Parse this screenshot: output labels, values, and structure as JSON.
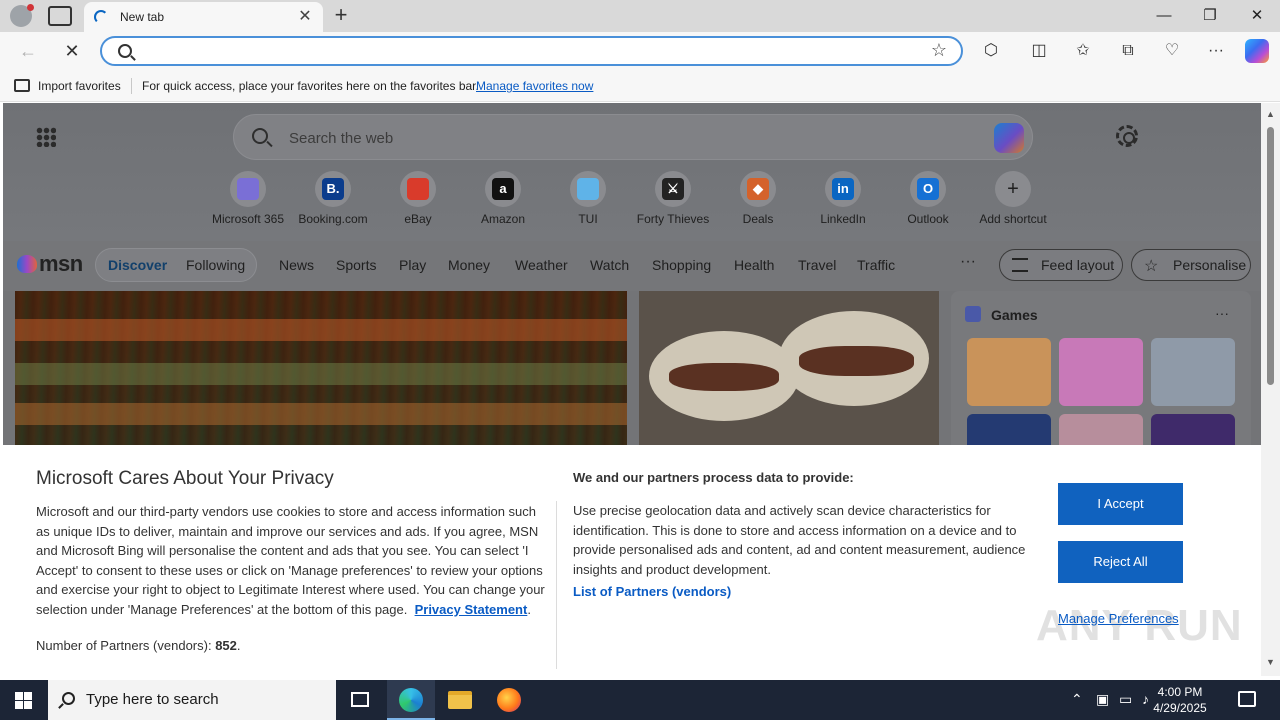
{
  "browser": {
    "tab_title": "New tab",
    "address_value": "",
    "favorites_bar": {
      "import_label": "Import favorites",
      "message": "For quick access, place your favorites here on the favorites bar.",
      "manage_link": "Manage favorites now"
    }
  },
  "newtab": {
    "search_placeholder": "Search the web",
    "shortcuts": [
      {
        "label": "Microsoft 365",
        "icon": "microsoft-365-icon",
        "glyph": "",
        "color": "#7a6fd6"
      },
      {
        "label": "Booking.com",
        "icon": "booking-icon",
        "glyph": "B.",
        "color": "#0b3c8c"
      },
      {
        "label": "eBay",
        "icon": "ebay-icon",
        "glyph": "",
        "color": "#d93b2b"
      },
      {
        "label": "Amazon",
        "icon": "amazon-icon",
        "glyph": "a",
        "color": "#111111"
      },
      {
        "label": "TUI",
        "icon": "tui-icon",
        "glyph": "",
        "color": "#5fb3e8"
      },
      {
        "label": "Forty Thieves",
        "icon": "forty-thieves-icon",
        "glyph": "⚔",
        "color": "#222222"
      },
      {
        "label": "Deals",
        "icon": "deals-icon",
        "glyph": "◆",
        "color": "#d4622b"
      },
      {
        "label": "LinkedIn",
        "icon": "linkedin-icon",
        "glyph": "in",
        "color": "#0a66c2"
      },
      {
        "label": "Outlook",
        "icon": "outlook-icon",
        "glyph": "O",
        "color": "#1570d4"
      },
      {
        "label": "Add shortcut",
        "icon": "plus-icon",
        "glyph": "+",
        "color": "transparent"
      }
    ]
  },
  "msn": {
    "logo": "msn",
    "discover": "Discover",
    "following": "Following",
    "nav": [
      "News",
      "Sports",
      "Play",
      "Money",
      "Weather",
      "Watch",
      "Shopping",
      "Health",
      "Travel",
      "Traffic"
    ],
    "more": "···",
    "feed_layout": "Feed layout",
    "personalise": "Personalise",
    "games_title": "Games",
    "games_more": "···"
  },
  "privacy": {
    "title": "Microsoft Cares About Your Privacy",
    "body": "Microsoft and our third-party vendors use cookies to store and access information such as unique IDs to deliver, maintain and improve our services and ads. If you agree, MSN and Microsoft Bing will personalise the content and ads that you see. You can select 'I Accept' to consent to these uses or click on 'Manage preferences' to review your options and exercise your right to object to Legitimate Interest where used.  You can change your selection under 'Manage Preferences' at the bottom of this page.",
    "privacy_link": "Privacy Statement",
    "partners_label": "Number of Partners (vendors):",
    "partners_count": "852",
    "right_heading": "We and our partners process data to provide:",
    "right_body": "Use precise geolocation data and actively scan device characteristics for identification. This is done to store and access information on a device and to provide personalised ads and content, ad and content measurement, audience insights and product development.",
    "list_partners": "List of Partners (vendors)",
    "accept": "I Accept",
    "reject": "Reject All",
    "manage": "Manage Preferences"
  },
  "watermark": "ANY RUN",
  "taskbar": {
    "search_placeholder": "Type here to search",
    "time": "4:00 PM",
    "date": "4/29/2025"
  }
}
